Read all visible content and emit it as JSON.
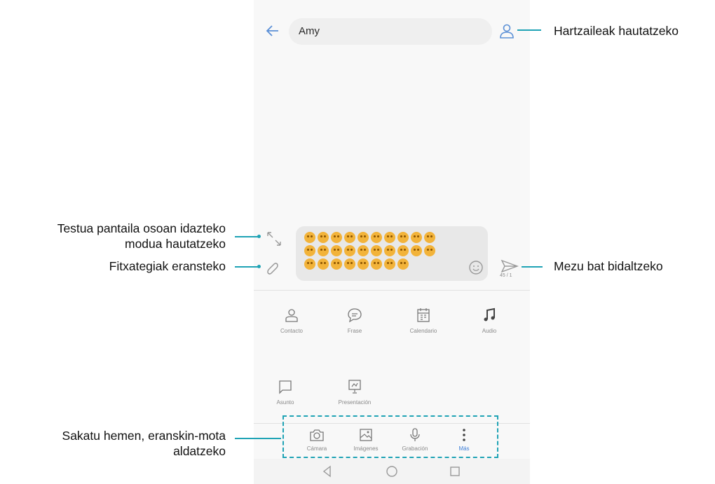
{
  "header": {
    "recipient": "Amy"
  },
  "compose": {
    "emoji_rows": [
      10,
      10,
      8
    ],
    "counter": "45 / 1"
  },
  "attachments": {
    "row1": [
      {
        "label": "Contacto",
        "icon": "person-icon"
      },
      {
        "label": "Frase",
        "icon": "chat-bubble-icon"
      },
      {
        "label": "Calendario",
        "icon": "calendar-icon"
      },
      {
        "label": "Audio",
        "icon": "music-note-icon"
      }
    ],
    "row2": [
      {
        "label": "Asunto",
        "icon": "subject-icon"
      },
      {
        "label": "Presentación",
        "icon": "presentation-icon"
      }
    ]
  },
  "tabs": [
    {
      "label": "Cámara",
      "icon": "camera-icon"
    },
    {
      "label": "Imágenes",
      "icon": "image-icon"
    },
    {
      "label": "Grabación",
      "icon": "microphone-icon"
    },
    {
      "label": "Más",
      "icon": "more-vertical-icon",
      "active": true
    }
  ],
  "annotations": {
    "recipients": "Hartzaileak hautatzeko",
    "fullscreen": "Testua pantaila osoan idazteko modua hautatzeko",
    "fullscreen_line1": "Testua pantaila osoan idazteko",
    "fullscreen_line2": "modua hautatzeko",
    "attach": "Fitxategiak eransteko",
    "send": "Mezu bat bidaltzeko",
    "tabs_line1": "Sakatu hemen, eranskin-mota",
    "tabs_line2": "aldatzeko"
  },
  "colors": {
    "accent": "#1fa3b5",
    "active_tab": "#3d7fd8",
    "emoji": "#f2b33a"
  }
}
